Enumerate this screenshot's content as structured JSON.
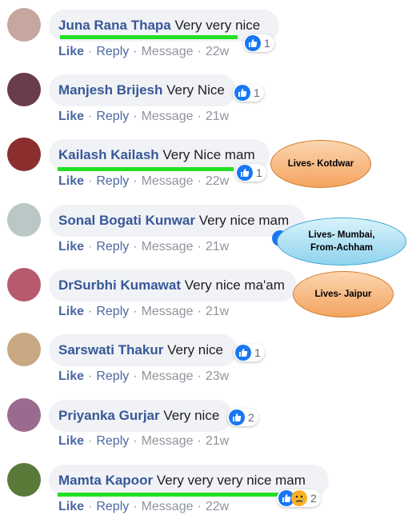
{
  "comments": [
    {
      "author": "Juna Rana Thapa",
      "text": "Very very nice",
      "time": "22w",
      "reactions": "1",
      "avatar_color": "#c7a6a0"
    },
    {
      "author": "Manjesh Brijesh",
      "text": "Very Nice",
      "time": "21w",
      "reactions": "1",
      "avatar_color": "#6b3b4e"
    },
    {
      "author": "Kailash Kailash",
      "text": "Very Nice mam",
      "time": "22w",
      "reactions": "1",
      "avatar_color": "#8a2e2e"
    },
    {
      "author": "Sonal Bogati Kunwar",
      "text": "Very nice mam",
      "time": "21w",
      "reactions": "",
      "avatar_color": "#b9c8c6"
    },
    {
      "author": "DrSurbhi Kumawat",
      "text": "Very nice ma'am",
      "time": "21w",
      "reactions": "",
      "avatar_color": "#b85a6e"
    },
    {
      "author": "Sarswati Thakur",
      "text": "Very nice",
      "time": "23w",
      "reactions": "1",
      "avatar_color": "#c8a882"
    },
    {
      "author": "Priyanka Gurjar",
      "text": "Very nice",
      "time": "21w",
      "reactions": "2",
      "avatar_color": "#9a6b8f"
    },
    {
      "author": "Mamta Kapoor",
      "text": "Very very very nice mam",
      "time": "22w",
      "reactions": "2",
      "avatar_color": "#5a7a3a"
    }
  ],
  "actions": {
    "like": "Like",
    "reply": "Reply",
    "message": "Message",
    "separator": "·"
  },
  "callouts": [
    {
      "line1": "Lives- Kotdwar",
      "line2": ""
    },
    {
      "line1": "Lives- Mumbai,",
      "line2": "From-Achham"
    },
    {
      "line1": "Lives- Jaipur",
      "line2": ""
    }
  ],
  "colors": {
    "author": "#385898",
    "highlight": "#22e022",
    "like": "#1877f2"
  }
}
